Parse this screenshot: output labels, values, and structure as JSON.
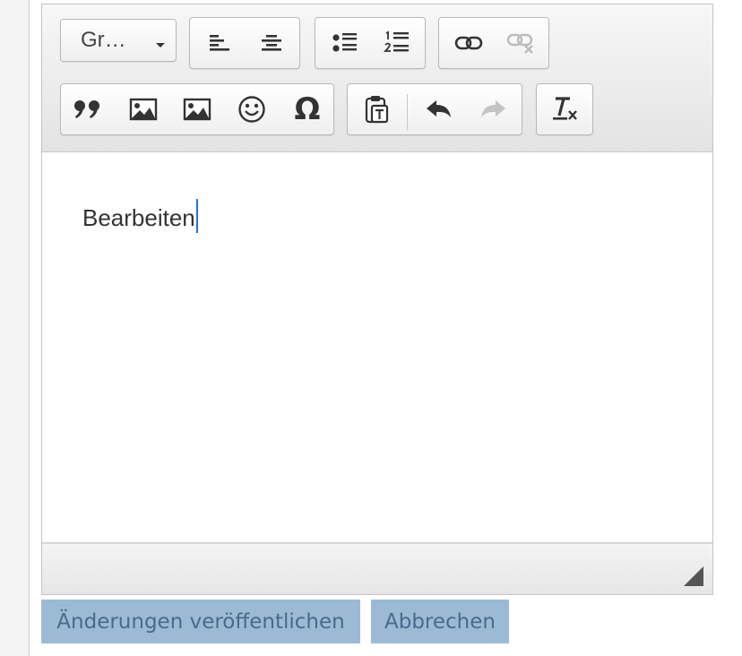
{
  "toolbar": {
    "format_combo": {
      "label": "Gr…",
      "icon": "chevron-down-icon"
    },
    "align_group": [
      "align-left-icon",
      "align-center-icon"
    ],
    "list_group": [
      "bulleted-list-icon",
      "numbered-list-icon"
    ],
    "link_group": [
      "link-icon",
      "unlink-icon"
    ],
    "insert_group": [
      "blockquote-icon",
      "image-icon",
      "image-icon",
      "smiley-icon",
      "special-character-icon"
    ],
    "special_character_glyph": "Ω",
    "history_group": [
      "paste-as-text-icon",
      "undo-icon",
      "redo-icon"
    ],
    "format_group": [
      "remove-format-icon"
    ]
  },
  "editor": {
    "content": "Bearbeiten"
  },
  "actions": {
    "publish_label": "Änderungen veröffentlichen",
    "cancel_label": "Abbrechen"
  },
  "colors": {
    "action_button_bg": "#9dbad5",
    "action_button_text": "#4a6a8b",
    "caret": "#2d6ddf"
  }
}
